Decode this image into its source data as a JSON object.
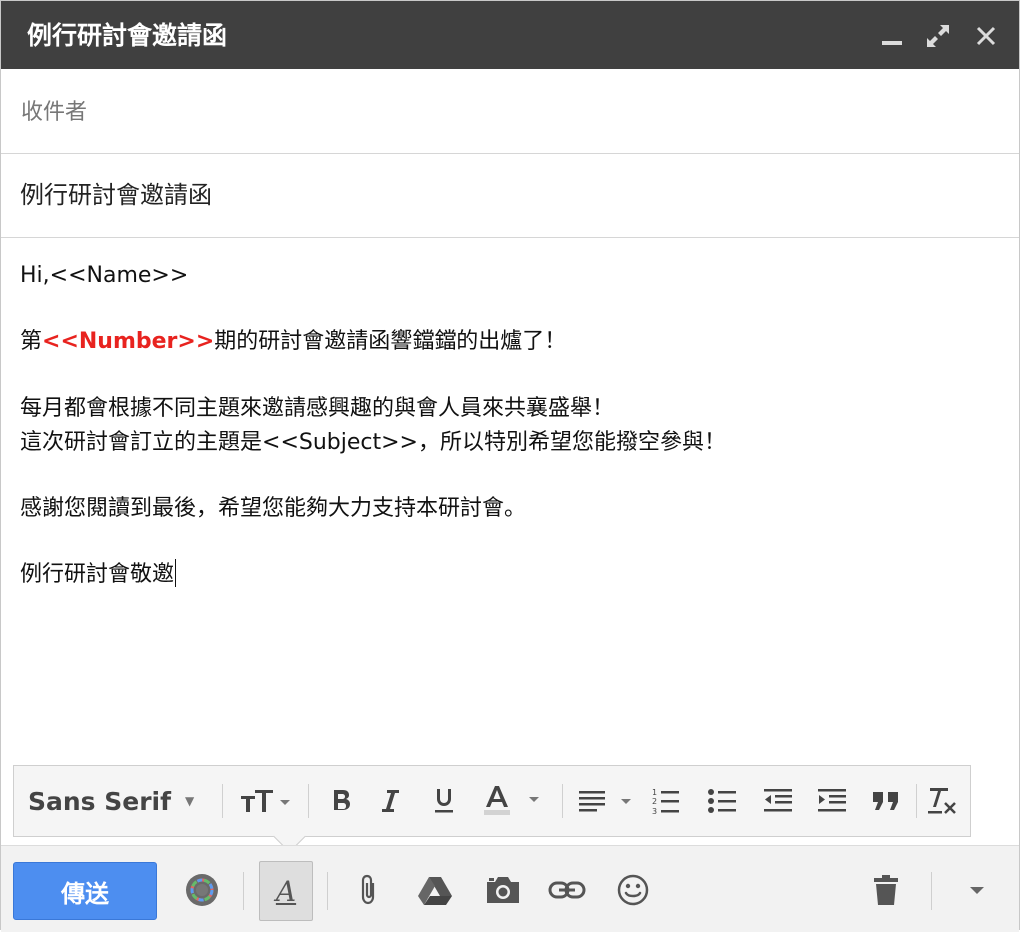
{
  "window": {
    "title": "例行研討會邀請函",
    "minimize_label": "_",
    "expand_label": "⤢",
    "close_label": "✕"
  },
  "to_field": {
    "placeholder": "收件者",
    "value": ""
  },
  "subject": {
    "value": "例行研討會邀請函"
  },
  "body": {
    "greeting_prefix": "Hi,",
    "greeting_var": "<<Name>>",
    "line2_prefix": "第",
    "line2_var": "<<Number>>",
    "line2_suffix": "期的研討會邀請函響鐺鐺的出爐了！",
    "para2_line1": "每月都會根據不同主題來邀請感興趣的與會人員來共襄盛舉！",
    "para2_line2_prefix": "這次研討會訂立的主題是",
    "para2_line2_var": "<<Subject>>",
    "para2_line2_suffix": "，所以特別希望您能撥空參與！",
    "para3": "感謝您閱讀到最後，希望您能夠大力支持本研討會。",
    "signature": "例行研討會敬邀"
  },
  "format_toolbar": {
    "font_family": "Sans Serif",
    "icons": [
      "font-size-icon",
      "bold-icon",
      "italic-icon",
      "underline-icon",
      "text-color-icon",
      "align-icon",
      "numbered-list-icon",
      "bulleted-list-icon",
      "indent-less-icon",
      "indent-more-icon",
      "quote-icon",
      "remove-formatting-icon"
    ]
  },
  "bottom_toolbar": {
    "send_label": "傳送",
    "icons": [
      "smart-compose-icon",
      "formatting-toggle-icon",
      "attach-icon",
      "drive-icon",
      "camera-icon",
      "link-icon",
      "emoji-icon",
      "trash-icon",
      "more-options-icon"
    ]
  },
  "colors": {
    "titlebar": "#404040",
    "send_button": "#4d8ef0",
    "variable_red": "#e8231f"
  }
}
